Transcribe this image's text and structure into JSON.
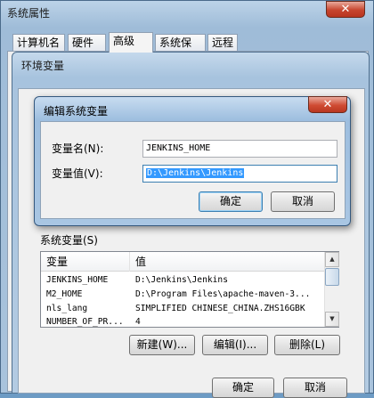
{
  "system_properties": {
    "title": "系统属性",
    "close_glyph": "✕",
    "tabs": [
      "计算机名",
      "硬件",
      "高级",
      "系统保护",
      "远程"
    ],
    "active_tab": "高级",
    "ok_label": "确定",
    "cancel_label": "取消"
  },
  "env_vars": {
    "title": "环境变量",
    "system_vars_label": "系统变量(S)",
    "columns": [
      "变量",
      "值"
    ],
    "rows": [
      {
        "var": "JENKINS_HOME",
        "value": "D:\\Jenkins\\Jenkins"
      },
      {
        "var": "M2_HOME",
        "value": "D:\\Program Files\\apache-maven-3..."
      },
      {
        "var": "nls_lang",
        "value": "SIMPLIFIED CHINESE_CHINA.ZHS16GBK"
      },
      {
        "var": "NUMBER_OF_PR...",
        "value": "4"
      }
    ],
    "new_label": "新建(W)...",
    "edit_label": "编辑(I)...",
    "delete_label": "删除(L)",
    "ok_label": "确定",
    "cancel_label": "取消"
  },
  "edit_dialog": {
    "title": "编辑系统变量",
    "close_glyph": "✕",
    "name_label": "变量名(N):",
    "value_label": "变量值(V):",
    "name_value": "JENKINS_HOME",
    "value_value": "D:\\Jenkins\\Jenkins",
    "ok_label": "确定",
    "cancel_label": "取消"
  }
}
